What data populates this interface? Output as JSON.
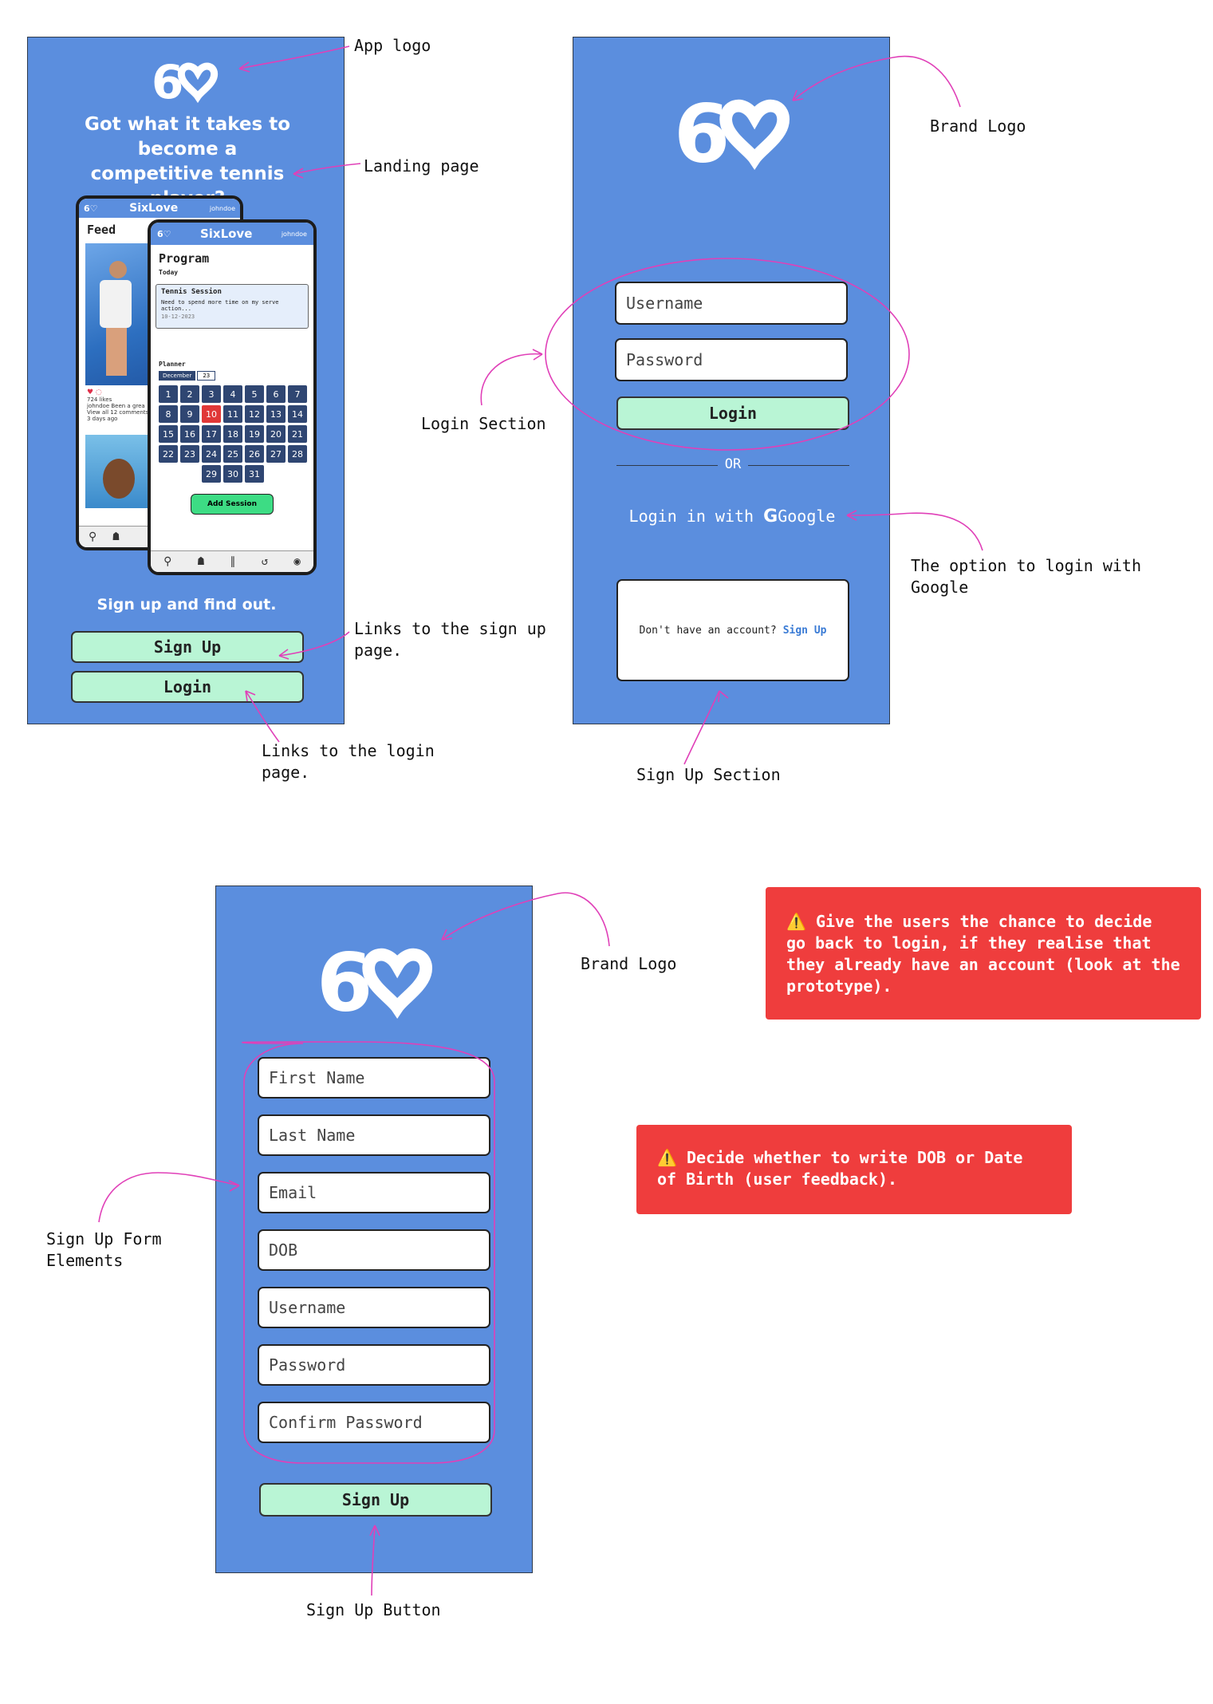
{
  "landing": {
    "headline": "Got what it takes to become a competitive tennis player?",
    "tagline": "Sign up and find out.",
    "signup_label": "Sign Up",
    "login_label": "Login",
    "phone_back": {
      "app_name": "SixLove",
      "user": "johndoe",
      "section": "Feed",
      "likes": "724 likes",
      "caption": "johndoe Been a grea",
      "comments": "View all 12 comments",
      "time": "3 days ago"
    },
    "phone_front": {
      "app_name": "SixLove",
      "user": "johndoe",
      "section": "Program",
      "today": "Today",
      "session_title": "Tennis Session",
      "session_desc": "Need to spend more time on my serve action...",
      "session_date": "10-12-2023",
      "planner": "Planner",
      "month": "December",
      "year": "23",
      "days": [
        "1",
        "2",
        "3",
        "4",
        "5",
        "6",
        "7",
        "8",
        "9",
        "10",
        "11",
        "12",
        "13",
        "14",
        "15",
        "16",
        "17",
        "18",
        "19",
        "20",
        "21",
        "22",
        "23",
        "24",
        "25",
        "26",
        "27",
        "28",
        "29",
        "30",
        "31"
      ],
      "today_day": "10",
      "add_session": "Add Session"
    }
  },
  "login": {
    "username_placeholder": "Username",
    "password_placeholder": "Password",
    "login_label": "Login",
    "or_label": "OR",
    "google_label_prefix": "Login in with",
    "google_label": "Google",
    "no_account": "Don't have an account?",
    "signup_link": "Sign Up"
  },
  "signup": {
    "fields": [
      "First Name",
      "Last Name",
      "Email",
      "DOB",
      "Username",
      "Password",
      "Confirm Password"
    ],
    "signup_label": "Sign Up"
  },
  "annotations": {
    "app_logo": "App logo",
    "landing_page": "Landing page",
    "links_signup": "Links to the sign up\npage.",
    "links_login": "Links to the login\npage.",
    "brand_logo_1": "Brand Logo",
    "login_section": "Login Section",
    "google_option": "The option to login with\nGoogle",
    "signup_section": "Sign Up Section",
    "brand_logo_2": "Brand Logo",
    "signup_form": "Sign Up Form\nElements",
    "signup_button": "Sign Up Button"
  },
  "warnings": {
    "back_to_login": "Give the users the chance to decide go back to login, if they realise that they already have an account (look at the prototype).",
    "dob": "Decide whether to write DOB or Date of Birth (user feedback)."
  },
  "colors": {
    "screen_bg": "#5b8ede",
    "button_bg": "#b9f5d5",
    "warning_bg": "#ef3d3d",
    "annotation_stroke": "#e040b8"
  }
}
